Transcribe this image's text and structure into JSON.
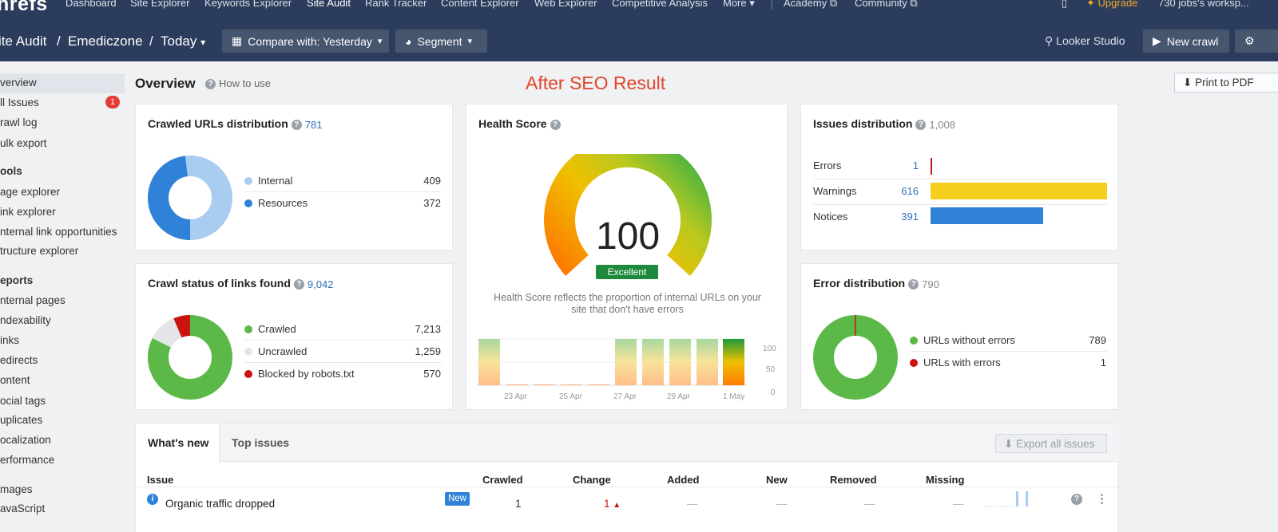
{
  "nav": {
    "logo": "hrefs",
    "items": [
      "Dashboard",
      "Site Explorer",
      "Keywords Explorer",
      "Site Audit",
      "Rank Tracker",
      "Content Explorer",
      "Web Explorer",
      "Competitive Analysis",
      "More",
      "Academy",
      "Community"
    ],
    "upgrade": "Upgrade",
    "workspace": "730 jobs's worksp..."
  },
  "header": {
    "crumb_section": "ite Audit",
    "crumb_project": "Emediczone",
    "crumb_date": "Today",
    "compare_label": "Compare with: Yesterday",
    "segment_label": "Segment",
    "looker_label": "Looker Studio",
    "new_crawl_label": "New crawl"
  },
  "sidebar": {
    "top_items": [
      "verview",
      "ll Issues",
      "rawl log",
      "ulk export"
    ],
    "issues_badge": "1",
    "tools_heading": "ools",
    "tools": [
      "age explorer",
      "ink explorer",
      "nternal link opportunities",
      "tructure explorer"
    ],
    "reports_heading": "eports",
    "reports": [
      "nternal pages",
      "ndexability",
      "inks",
      "edirects",
      "ontent",
      "ocial tags",
      "uplicates",
      "ocalization",
      "erformance"
    ],
    "extra": [
      "mages",
      "avaScript"
    ]
  },
  "overview": {
    "title": "Overview",
    "how_to": "How to use",
    "annotation": "After SEO Result",
    "print_label": "Print to PDF"
  },
  "crawled_urls": {
    "title": "Crawled URLs distribution",
    "total": "781",
    "legend": [
      {
        "label": "Internal",
        "value": "409",
        "color": "#a8cdf0"
      },
      {
        "label": "Resources",
        "value": "372",
        "color": "#2f82d8"
      }
    ]
  },
  "crawl_status": {
    "title": "Crawl status of links found",
    "total": "9,042",
    "legend": [
      {
        "label": "Crawled",
        "value": "7,213",
        "color": "#5cb947"
      },
      {
        "label": "Uncrawled",
        "value": "1,259",
        "color": "#e3e5e8"
      },
      {
        "label": "Blocked by robots.txt",
        "value": "570",
        "color": "#cc1111"
      }
    ]
  },
  "health": {
    "title": "Health Score",
    "score": "100",
    "score_label": "Excellent",
    "score_fraction": 1.0,
    "description": "Health Score reflects the proportion of internal URLs on your site that don't have errors",
    "x_labels": [
      "23 Apr",
      "25 Apr",
      "27 Apr",
      "29 Apr",
      "1 May"
    ],
    "y_labels": [
      "100",
      "50",
      "0"
    ]
  },
  "issues_dist": {
    "title": "Issues distribution",
    "total": "1,008",
    "rows": [
      {
        "label": "Errors",
        "value": "1",
        "color": "#b71c1c"
      },
      {
        "label": "Warnings",
        "value": "616",
        "color": "#f5cf1e"
      },
      {
        "label": "Notices",
        "value": "391",
        "color": "#2f82d8"
      }
    ]
  },
  "error_dist": {
    "title": "Error distribution",
    "total": "790",
    "legend": [
      {
        "label": "URLs without errors",
        "value": "789",
        "color": "#5cb947"
      },
      {
        "label": "URLs with errors",
        "value": "1",
        "color": "#cc1111"
      }
    ]
  },
  "issues_table": {
    "tabs": [
      "What's new",
      "Top issues"
    ],
    "export_label": "Export all issues",
    "columns": [
      "Issue",
      "Crawled",
      "Change",
      "Added",
      "New",
      "Removed",
      "Missing"
    ],
    "rows": [
      {
        "issue": "Organic traffic dropped",
        "badge": "New",
        "crawled": "1",
        "change": "1",
        "added": "—",
        "new": "—",
        "removed": "—",
        "missing": "—"
      }
    ]
  },
  "colors": {
    "nav_bg": "#2c3c5c",
    "accent": "#2f6fb5",
    "upgrade": "#f5a623",
    "annotation": "#e0452a",
    "excellent": "#1c8a3a"
  }
}
